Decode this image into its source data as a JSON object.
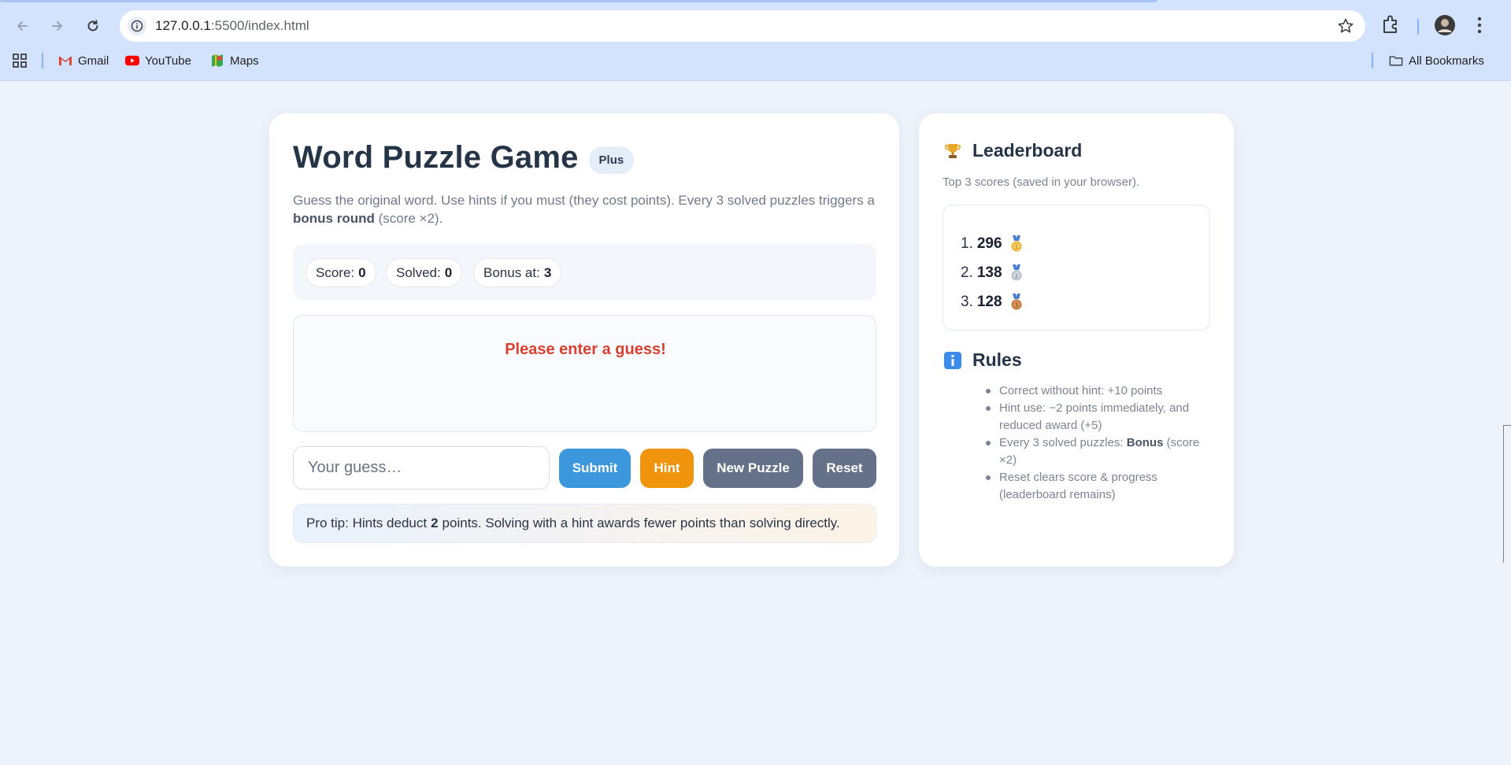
{
  "browser": {
    "url_host": "127.0.0.1",
    "url_rest": ":5500/index.html",
    "bookmarks": [
      {
        "label": "Gmail",
        "icon": "gmail-icon"
      },
      {
        "label": "YouTube",
        "icon": "youtube-icon"
      },
      {
        "label": "Maps",
        "icon": "maps-icon"
      }
    ],
    "all_bookmarks": "All Bookmarks"
  },
  "game": {
    "title": "Word Puzzle Game",
    "badge": "Plus",
    "desc_part1": "Guess the original word. Use hints if you must (they cost points). Every 3 solved puzzles triggers a ",
    "desc_bold": "bonus round",
    "desc_part2": " (score ×2).",
    "stats": {
      "score_label": "Score:",
      "score_value": "0",
      "solved_label": "Solved:",
      "solved_value": "0",
      "bonus_label": "Bonus at:",
      "bonus_value": "3"
    },
    "message": "Please enter a guess!",
    "input_placeholder": "Your guess…",
    "buttons": {
      "submit": "Submit",
      "hint": "Hint",
      "new_puzzle": "New Puzzle",
      "reset": "Reset"
    },
    "tip_part1": "Pro tip: Hints deduct",
    "tip_bold": "2",
    "tip_part2": "points. Solving with a hint awards fewer points than solving directly."
  },
  "leaderboard": {
    "title": "Leaderboard",
    "subtitle": "Top 3 scores (saved in your browser).",
    "entries": [
      {
        "rank": "1.",
        "score": "296",
        "medal": "gold-medal-icon"
      },
      {
        "rank": "2.",
        "score": "138",
        "medal": "silver-medal-icon"
      },
      {
        "rank": "3.",
        "score": "128",
        "medal": "bronze-medal-icon"
      }
    ]
  },
  "rules": {
    "title": "Rules",
    "items": [
      {
        "text": "Correct without hint: +10 points"
      },
      {
        "text": "Hint use: −2 points immediately, and reduced award (+5)"
      },
      {
        "pre": "Every 3 solved puzzles: ",
        "bold": "Bonus",
        "post": " (score ×2)"
      },
      {
        "text": "Reset clears score & progress (leaderboard remains)"
      }
    ]
  },
  "colors": {
    "submit": "#3d97dc",
    "hint": "#f0940e",
    "neutral_button": "#647188",
    "error_message": "#d9402f",
    "page_background": "#eef3fb"
  }
}
